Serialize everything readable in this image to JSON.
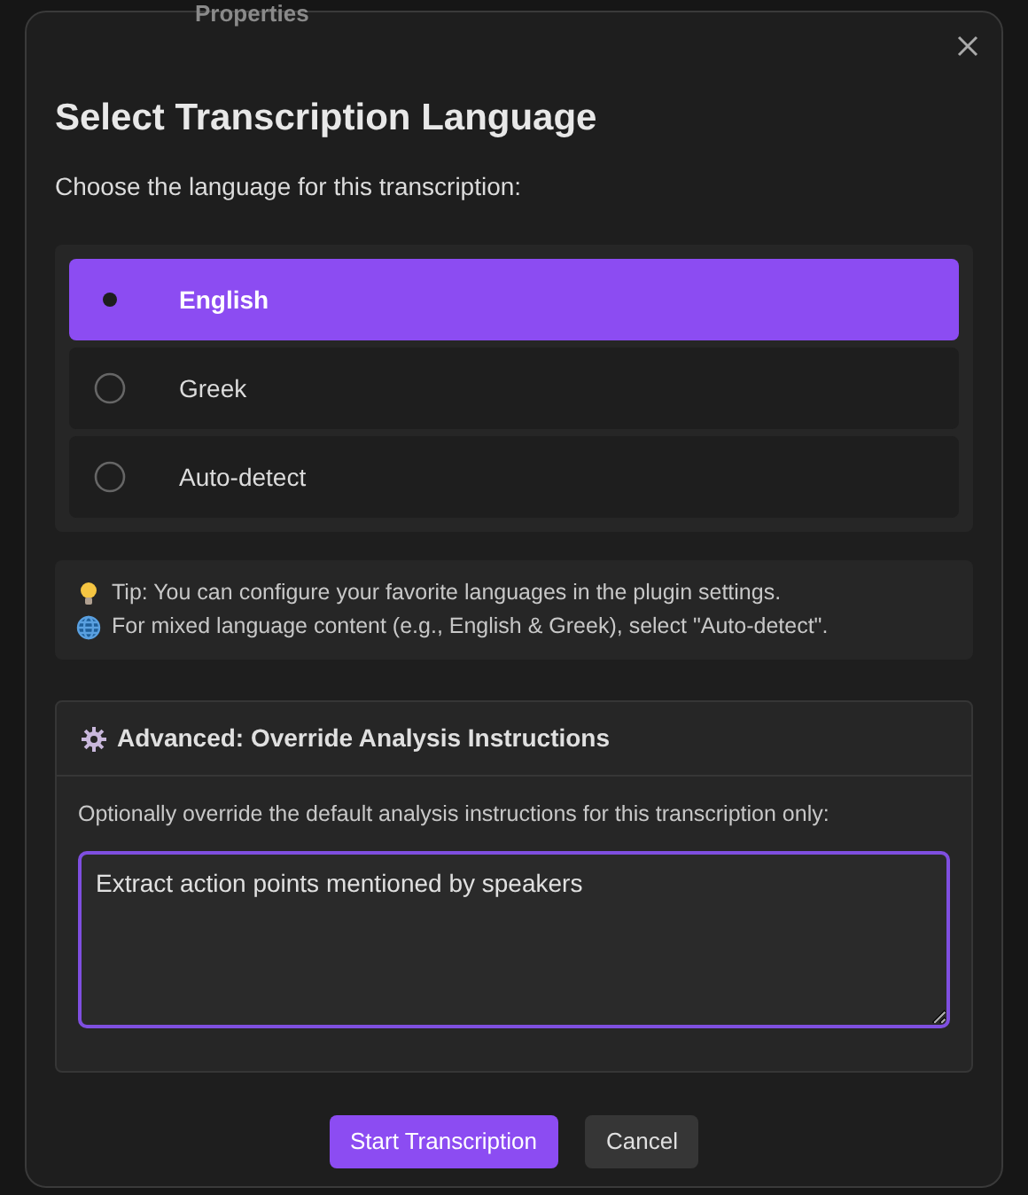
{
  "background": {
    "heading": "Properties"
  },
  "dialog": {
    "title": "Select Transcription Language",
    "subtitle": "Choose the language for this transcription:",
    "languages": [
      {
        "label": "English",
        "selected": true
      },
      {
        "label": "Greek",
        "selected": false
      },
      {
        "label": "Auto-detect",
        "selected": false
      }
    ],
    "tips": [
      {
        "kind": "bulb",
        "text": "Tip: You can configure your favorite languages in the plugin settings."
      },
      {
        "kind": "globe",
        "text": "For mixed language content (e.g., English & Greek), select \"Auto-detect\"."
      }
    ],
    "advanced": {
      "title": "Advanced: Override Analysis Instructions",
      "description": "Optionally override the default analysis instructions for this transcription only:",
      "value": "Extract action points mentioned by speakers"
    },
    "buttons": [
      {
        "kind": "primary",
        "label": "Start Transcription"
      },
      {
        "kind": "secondary",
        "label": "Cancel"
      }
    ]
  }
}
